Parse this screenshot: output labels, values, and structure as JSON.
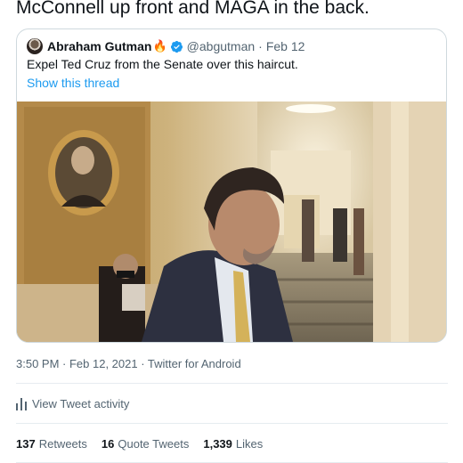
{
  "tweet": {
    "text": "McConnell up front and MAGA in the back."
  },
  "quoted_tweet": {
    "author_name": "Abraham Gutman",
    "author_emoji": "🔥",
    "handle": "@abgutman",
    "separator": "·",
    "date": "Feb 12",
    "text": "Expel Ted Cruz from the Senate over this haircut.",
    "show_thread": "Show this thread",
    "avatar_icon": "avatar",
    "verified_icon": "verified-badge-icon",
    "media_icon": "video-still"
  },
  "meta": {
    "timestamp_line": "3:50 PM · Feb 12, 2021 · Twitter for Android"
  },
  "activity": {
    "label": "View Tweet activity",
    "icon": "bar-chart-icon"
  },
  "stats": {
    "retweets_count": "137",
    "retweets_label": "Retweets",
    "quotes_count": "16",
    "quotes_label": "Quote Tweets",
    "likes_count": "1,339",
    "likes_label": "Likes"
  },
  "colors": {
    "link": "#1d9bf0",
    "muted": "#536471",
    "text": "#0f1419",
    "border": "#cfd9de"
  }
}
